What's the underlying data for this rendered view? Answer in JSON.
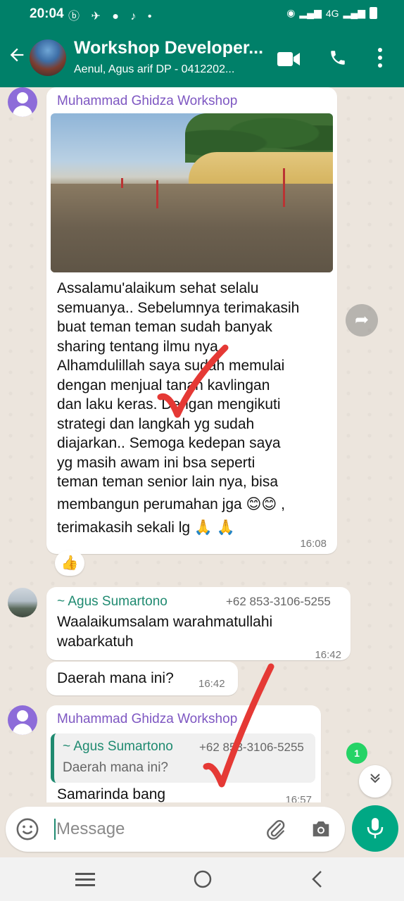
{
  "status_bar": {
    "time": "20:04",
    "network": "4G"
  },
  "header": {
    "title": "Workshop Developer...",
    "subtitle": "Aenul, Agus arif DP - 0412202..."
  },
  "messages": [
    {
      "sender": "Muhammad Ghidza Workshop",
      "lines": [
        "Assalamu'alaikum sehat selalu",
        "semuanya.. Sebelumnya terimakasih",
        "buat teman teman sudah banyak",
        "sharing tentang ilmu nya..",
        "Alhamdulillah saya sudah memulai",
        "dengan menjual tanah kavlingan",
        "dan laku keras. Dengan mengikuti",
        "strategi dan langkah yg sudah",
        "diajarkan.. Semoga kedepan saya",
        "yg masih awam ini bsa seperti",
        "teman teman senior lain nya, bisa",
        "membangun perumahan jga 😊😊 ,",
        "terimakasih sekali lg 🙏 🙏"
      ],
      "time": "16:08",
      "reaction": "👍"
    },
    {
      "sender": "~ Agus Sumartono",
      "phone": "+62 853-3106-5255",
      "lines": [
        "Waalaikumsalam warahmatullahi",
        "wabarkatuh"
      ],
      "time": "16:42"
    },
    {
      "text": "Daerah mana ini?",
      "time": "16:42"
    },
    {
      "sender": "Muhammad Ghidza Workshop",
      "quote": {
        "sender": "~ Agus Sumartono",
        "phone": "+62 853-3106-5255",
        "text": "Daerah mana ini?"
      },
      "text": "Samarinda bang",
      "time": "16:57"
    }
  ],
  "unread_badge": "1",
  "input": {
    "placeholder": "Message"
  },
  "colors": {
    "header": "#008069",
    "chat_bg": "#ece5dd",
    "sender_purple": "#7e57c2",
    "sender_green": "#1f8a70",
    "mic": "#00a884",
    "annotation_red": "#e53935"
  }
}
